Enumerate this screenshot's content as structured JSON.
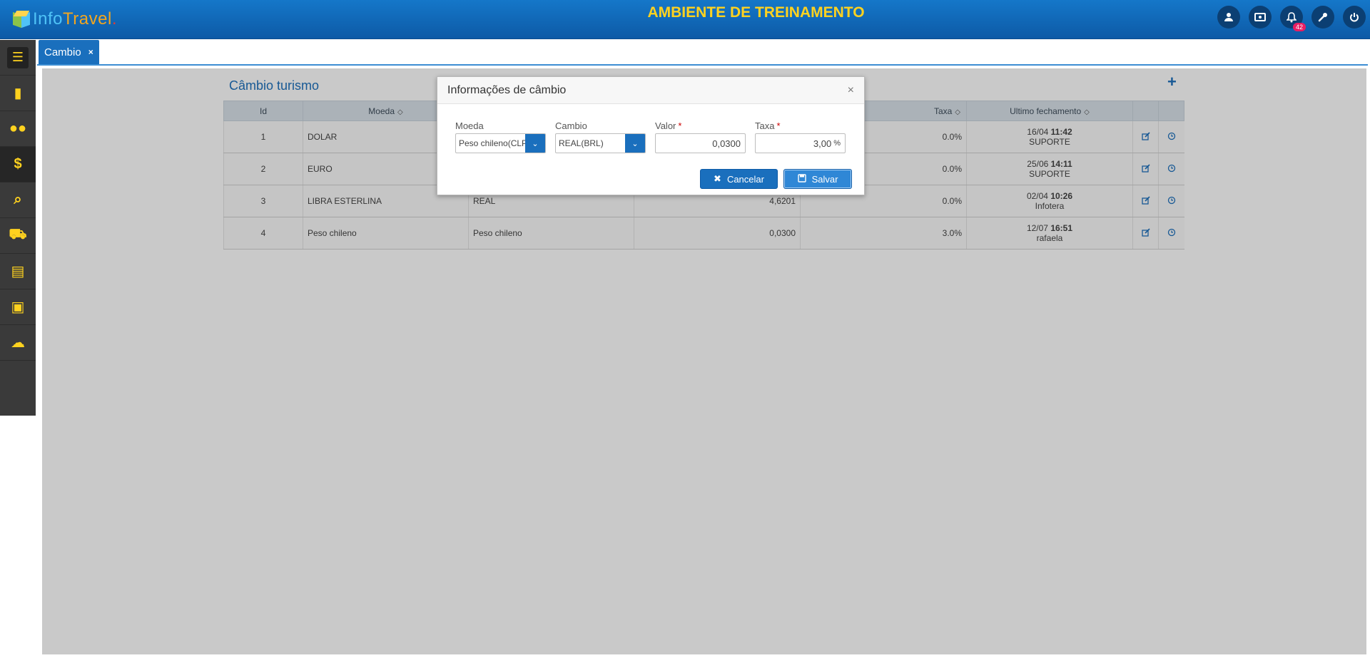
{
  "app": {
    "logo_text_a": "Info",
    "logo_text_b": "Travel",
    "logo_text_c": ".",
    "environment_title": "AMBIENTE DE TREINAMENTO",
    "notification_count": "42"
  },
  "sidebar": {
    "items": [
      "building-icon",
      "users-icon",
      "dollar-icon",
      "search-icon",
      "cart-icon",
      "document-icon",
      "money-icon",
      "cloud-icon"
    ]
  },
  "tabs": [
    {
      "label": "Cambio",
      "close": "×"
    }
  ],
  "page": {
    "title": "Câmbio turismo",
    "add_symbol": "+"
  },
  "table": {
    "headers": {
      "id": "Id",
      "moeda": "Moeda",
      "taxa": "Taxa",
      "ultimo": "Ultimo fechamento"
    },
    "rows": [
      {
        "id": "1",
        "moeda": "DOLAR",
        "cambio": "",
        "valor": "",
        "taxa": "0.0%",
        "date": "16/04",
        "time": "11:42",
        "user": "SUPORTE"
      },
      {
        "id": "2",
        "moeda": "EURO",
        "cambio": "",
        "valor": "",
        "taxa": "0.0%",
        "date": "25/06",
        "time": "14:11",
        "user": "SUPORTE"
      },
      {
        "id": "3",
        "moeda": "LIBRA ESTERLINA",
        "cambio": "REAL",
        "valor": "4,6201",
        "taxa": "0.0%",
        "date": "02/04",
        "time": "10:26",
        "user": "Infotera"
      },
      {
        "id": "4",
        "moeda": "Peso chileno",
        "cambio": "Peso chileno",
        "valor": "0,0300",
        "taxa": "3.0%",
        "date": "12/07",
        "time": "16:51",
        "user": "rafaela"
      }
    ]
  },
  "modal": {
    "title": "Informações de câmbio",
    "close": "×",
    "moeda_label": "Moeda",
    "moeda_value": "Peso chileno(CLP)",
    "cambio_label": "Cambio",
    "cambio_value": "REAL(BRL)",
    "valor_label": "Valor",
    "valor_value": "0,0300",
    "taxa_label": "Taxa",
    "taxa_value": "3,00",
    "taxa_unit": "%",
    "required_mark": "*",
    "cancel_label": "Cancelar",
    "save_label": "Salvar"
  },
  "colors": {
    "brand": "#1a6fbd",
    "accent": "#ffd21f"
  }
}
